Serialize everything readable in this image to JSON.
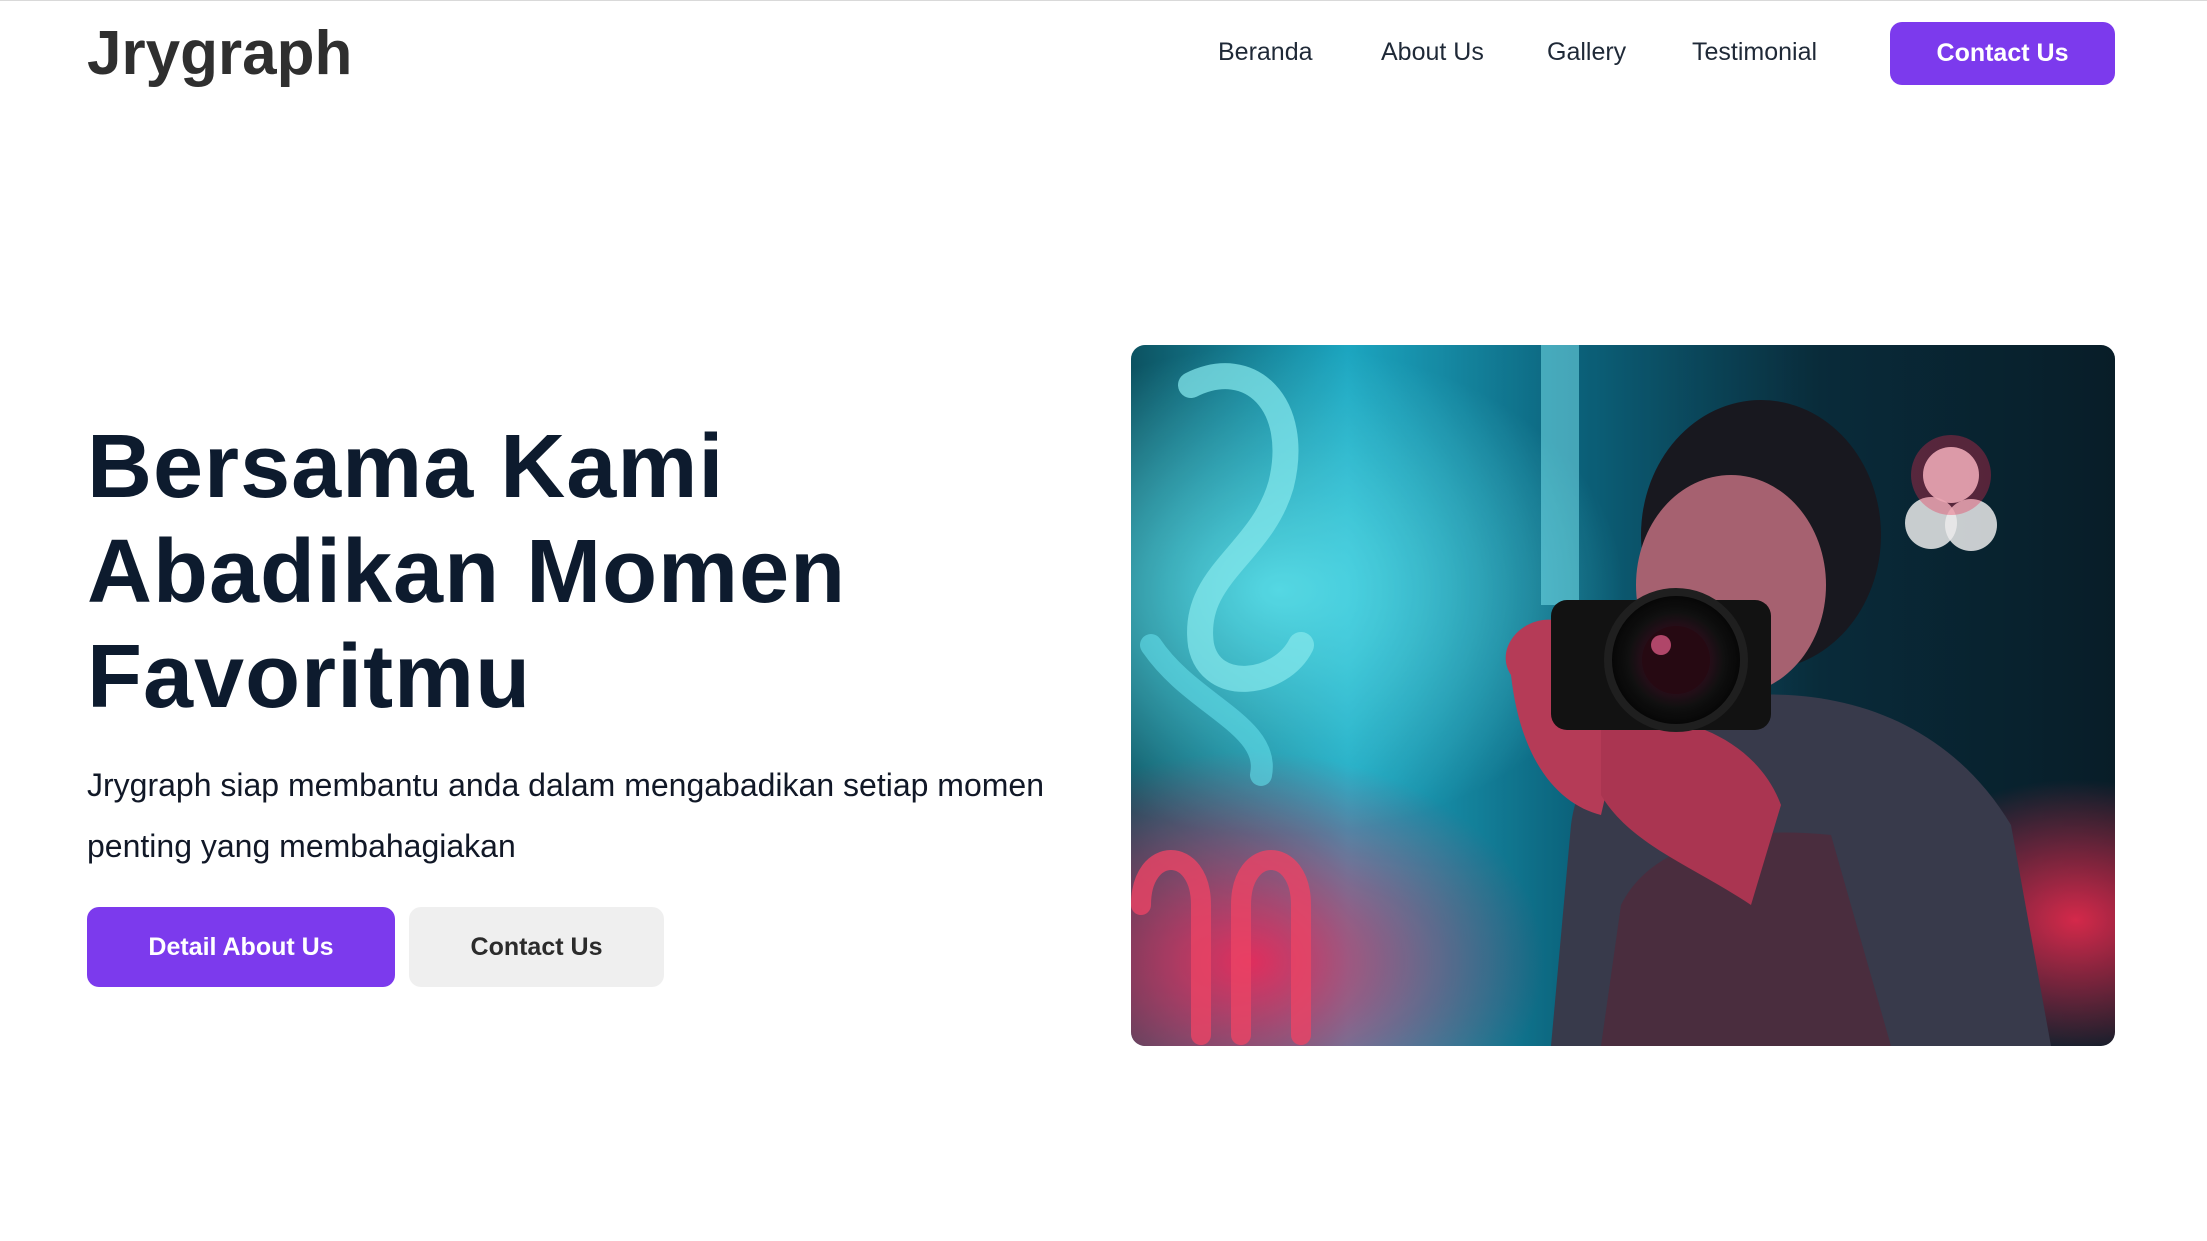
{
  "navbar": {
    "logo": "Jrygraph",
    "links": [
      "Beranda",
      "About Us",
      "Gallery",
      "Testimonial"
    ],
    "cta_label": "Contact Us"
  },
  "hero": {
    "title_lines": [
      "Bersama Kami",
      "Abadikan Momen",
      "Favoritmu"
    ],
    "description": "Jrygraph siap membantu anda dalam mengabadikan setiap momen penting yang membahagiakan",
    "primary_button": "Detail About Us",
    "secondary_button": "Contact Us"
  },
  "colors": {
    "accent": "#7c3aed",
    "heading": "#0d1b2e",
    "secondary_button_bg": "#efefef"
  }
}
